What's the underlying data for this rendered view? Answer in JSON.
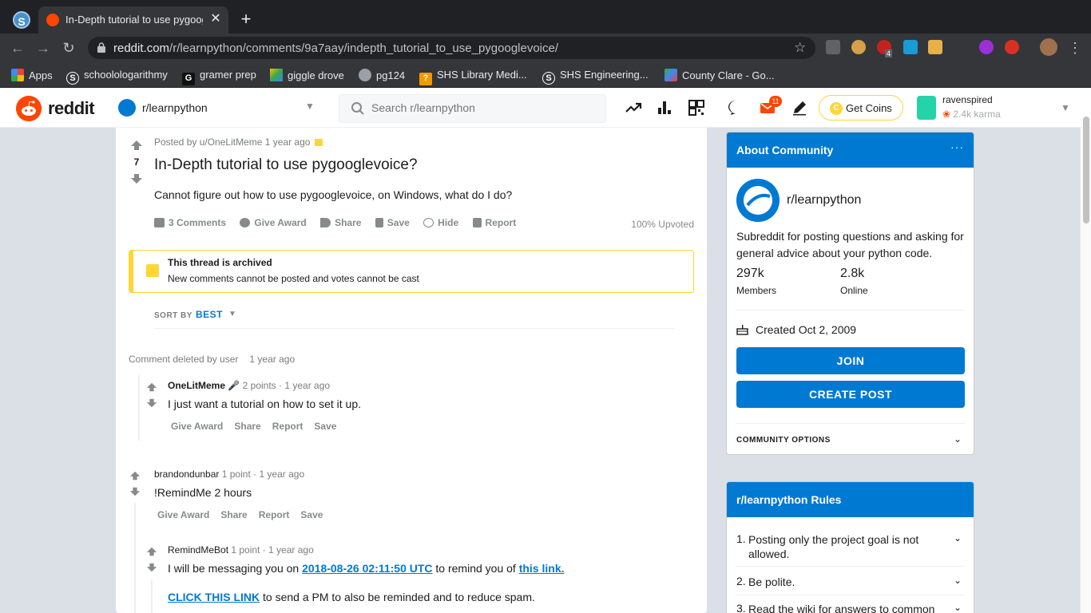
{
  "browser": {
    "tab_title": "In-Depth tutorial to use pygoogl",
    "tab_close": "✕",
    "new_tab": "+",
    "url_host": "reddit.com",
    "url_path": "/r/learnpython/comments/9a7aay/indepth_tutorial_to_use_pygooglevoice/",
    "bookmarks": [
      "Apps",
      "schoolologarithmy",
      "gramer prep",
      "giggle drove",
      "pg124",
      "SHS Library Medi...",
      "SHS Engineering...",
      "County Clare - Go..."
    ],
    "ext_badge": "4"
  },
  "header": {
    "wordmark": "reddit",
    "community": "r/learnpython",
    "search_placeholder": "Search r/learnpython",
    "mail_count": "11",
    "coins_label": "Get Coins",
    "username": "ravenspired",
    "karma": "2.4k karma"
  },
  "post": {
    "votes": "7",
    "meta": "Posted by u/OneLitMeme 1 year ago",
    "title": "In-Depth tutorial to use pygooglevoice?",
    "body": "Cannot figure out how to use pygooglevoice, on Windows, what do I do?",
    "actions": [
      "3 Comments",
      "Give Award",
      "Share",
      "Save",
      "Hide",
      "Report"
    ],
    "upvoted": "100% Upvoted",
    "archived_title": "This thread is archived",
    "archived_text": "New comments cannot be posted and votes cannot be cast",
    "sort_label": "SORT BY",
    "sort_value": "BEST"
  },
  "comments": {
    "deleted": "Comment deleted by user",
    "deleted_time": "1 year ago",
    "c1": {
      "author": "OneLitMeme",
      "meta": "2 points · 1 year ago",
      "text": "I just want a tutorial on how to set it up."
    },
    "c2": {
      "author": "brandondunbar",
      "meta": "1 point · 1 year ago",
      "text": "!RemindMe 2 hours"
    },
    "c3": {
      "author": "RemindMeBot",
      "meta": "1 point · 1 year ago",
      "text_pre": "I will be messaging you on ",
      "date_link": "2018-08-26 02:11:50 UTC",
      "text_mid": " to remind you of ",
      "this_link": "this link.",
      "cta_link": "CLICK THIS LINK",
      "cta_text": " to send a PM to also be reminded and to reduce spam."
    },
    "actions": [
      "Give Award",
      "Share",
      "Report",
      "Save"
    ]
  },
  "sidebar": {
    "about_title": "About Community",
    "about_menu": "···",
    "name": "r/learnpython",
    "description": "Subreddit for posting questions and asking for general advice about your python code.",
    "members_value": "297k",
    "members_label": "Members",
    "online_value": "2.8k",
    "online_label": "Online",
    "created": "Created Oct 2, 2009",
    "join": "JOIN",
    "create_post": "CREATE POST",
    "community_options": "COMMUNITY OPTIONS",
    "rules_title": "r/learnpython Rules",
    "rules": [
      {
        "num": "1.",
        "text": "Posting only the project goal is not allowed."
      },
      {
        "num": "2.",
        "text": "Be polite."
      },
      {
        "num": "3.",
        "text": "Read the wiki for answers to common"
      }
    ]
  },
  "colors": {
    "accent": "#0079d3",
    "orangered": "#ff4500",
    "archived": "#ffd635"
  }
}
